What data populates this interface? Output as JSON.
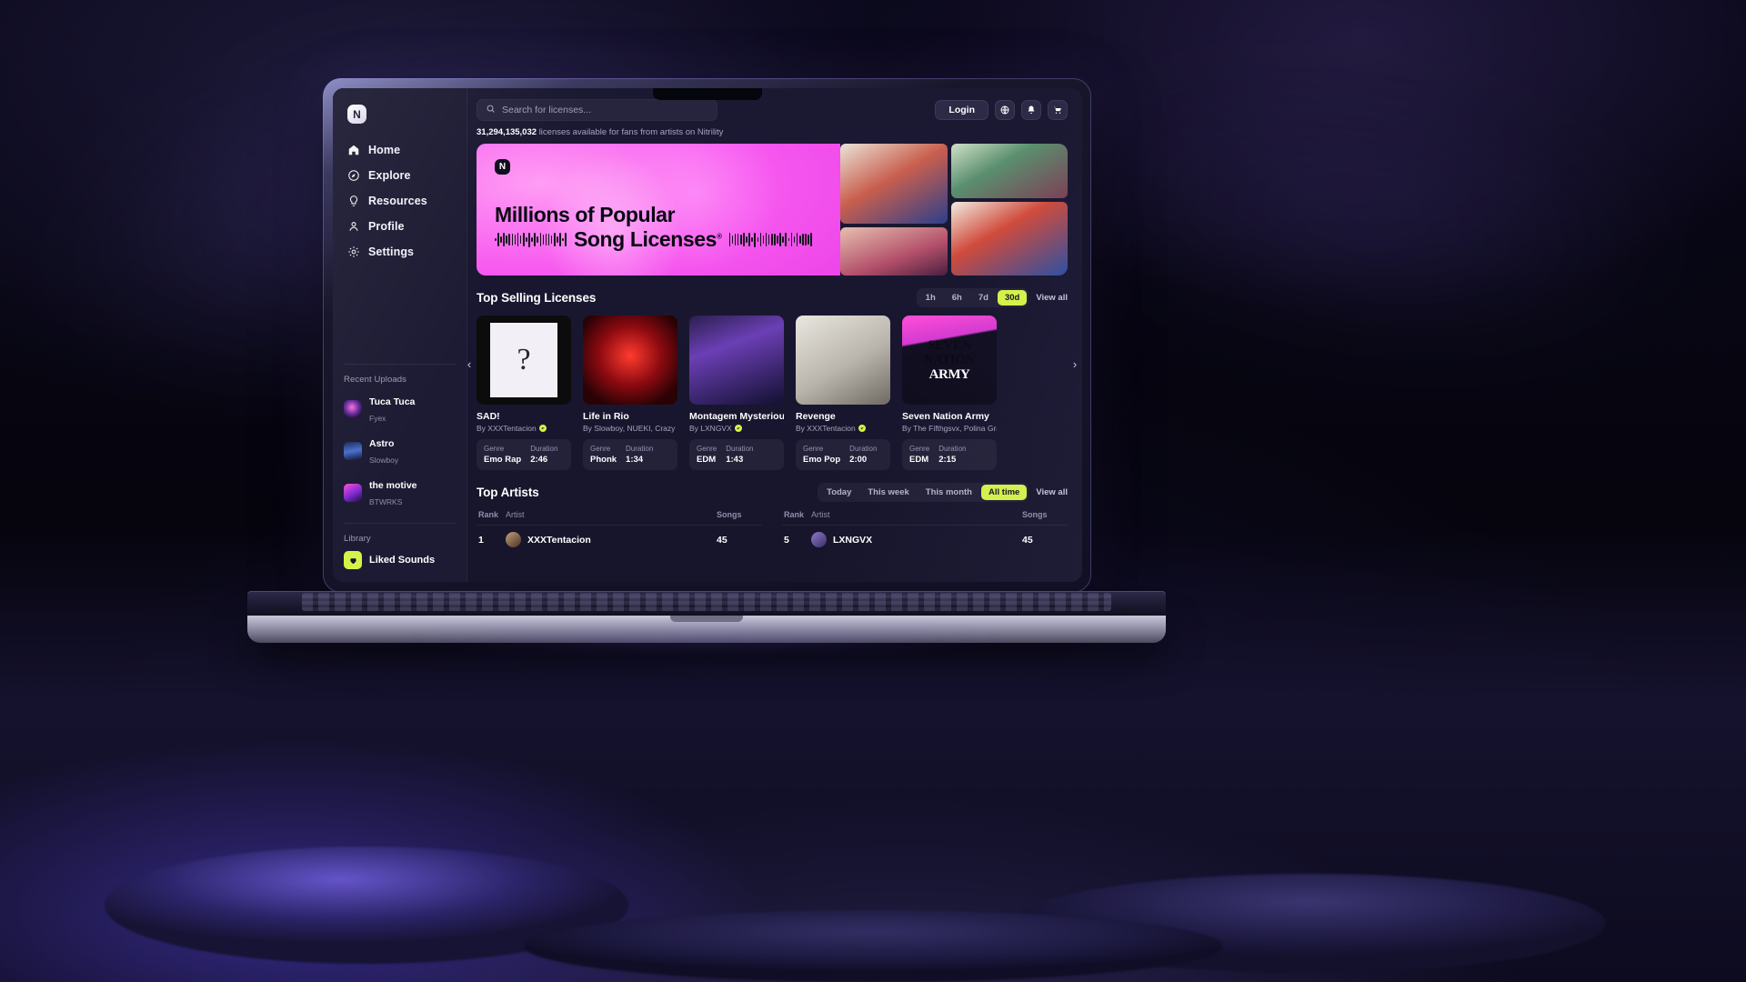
{
  "sidebar": {
    "brand_initial": "N",
    "nav": [
      {
        "label": "Home",
        "icon": "home-icon"
      },
      {
        "label": "Explore",
        "icon": "compass-icon"
      },
      {
        "label": "Resources",
        "icon": "bulb-icon"
      },
      {
        "label": "Profile",
        "icon": "user-icon"
      },
      {
        "label": "Settings",
        "icon": "gear-icon"
      }
    ],
    "recent_uploads_title": "Recent Uploads",
    "recent_uploads": [
      {
        "title": "Tuca Tuca",
        "artist": "Fyex"
      },
      {
        "title": "Astro",
        "artist": "Slowboy"
      },
      {
        "title": "the motive",
        "artist": "BTWRKS"
      }
    ],
    "library_title": "Library",
    "liked_sounds_label": "Liked Sounds"
  },
  "header": {
    "search_placeholder": "Search for licenses...",
    "search_value": "",
    "login_label": "Login",
    "icons": [
      "globe-icon",
      "bell-icon",
      "cart-icon"
    ],
    "counter_number": "31,294,135,032",
    "counter_text": "licenses available for fans from artists on Nitrility"
  },
  "hero": {
    "logo_initial": "N",
    "line1": "Millions of Popular",
    "line2": "Song Licenses",
    "superscript": "®"
  },
  "top_selling": {
    "title": "Top Selling Licenses",
    "filters": [
      "1h",
      "6h",
      "7d",
      "30d"
    ],
    "active_filter": "30d",
    "view_all": "View all",
    "meta_labels": {
      "genre": "Genre",
      "duration": "Duration"
    },
    "cards": [
      {
        "title": "SAD!",
        "by": "By XXXTentacion",
        "verified": true,
        "genre": "Emo Rap",
        "duration": "2:46",
        "art": "art1"
      },
      {
        "title": "Life in Rio",
        "by": "By Slowboy, NUEKI, Crazy Man",
        "verified": false,
        "genre": "Phonk",
        "duration": "1:34",
        "art": "art2"
      },
      {
        "title": "Montagem Mysterious",
        "by": "By LXNGVX",
        "verified": true,
        "genre": "EDM",
        "duration": "1:43",
        "art": "art3"
      },
      {
        "title": "Revenge",
        "by": "By XXXTentacion",
        "verified": true,
        "genre": "Emo Pop",
        "duration": "2:00",
        "art": "art4"
      },
      {
        "title": "Seven Nation Army",
        "by": "By The Fifthgsvx, Polina Grace",
        "verified": false,
        "genre": "EDM",
        "duration": "2:15",
        "art": "art5"
      }
    ],
    "art5_words": [
      "SEVEN",
      "NATION",
      "ARMY"
    ]
  },
  "top_artists": {
    "title": "Top Artists",
    "filters": [
      "Today",
      "This week",
      "This month",
      "All time"
    ],
    "active_filter": "All time",
    "view_all": "View all",
    "columns": {
      "rank": "Rank",
      "artist": "Artist",
      "songs": "Songs"
    },
    "left_rows": [
      {
        "rank": "1",
        "artist": "XXXTentacion",
        "songs": "45"
      }
    ],
    "right_rows": [
      {
        "rank": "5",
        "artist": "LXNGVX",
        "songs": "45"
      }
    ]
  },
  "colors": {
    "accent_lime": "#d4f24a",
    "hero_pink": "#f85cf0",
    "sidebar_bg": "#1d1b33",
    "app_bg": "#17152b"
  }
}
